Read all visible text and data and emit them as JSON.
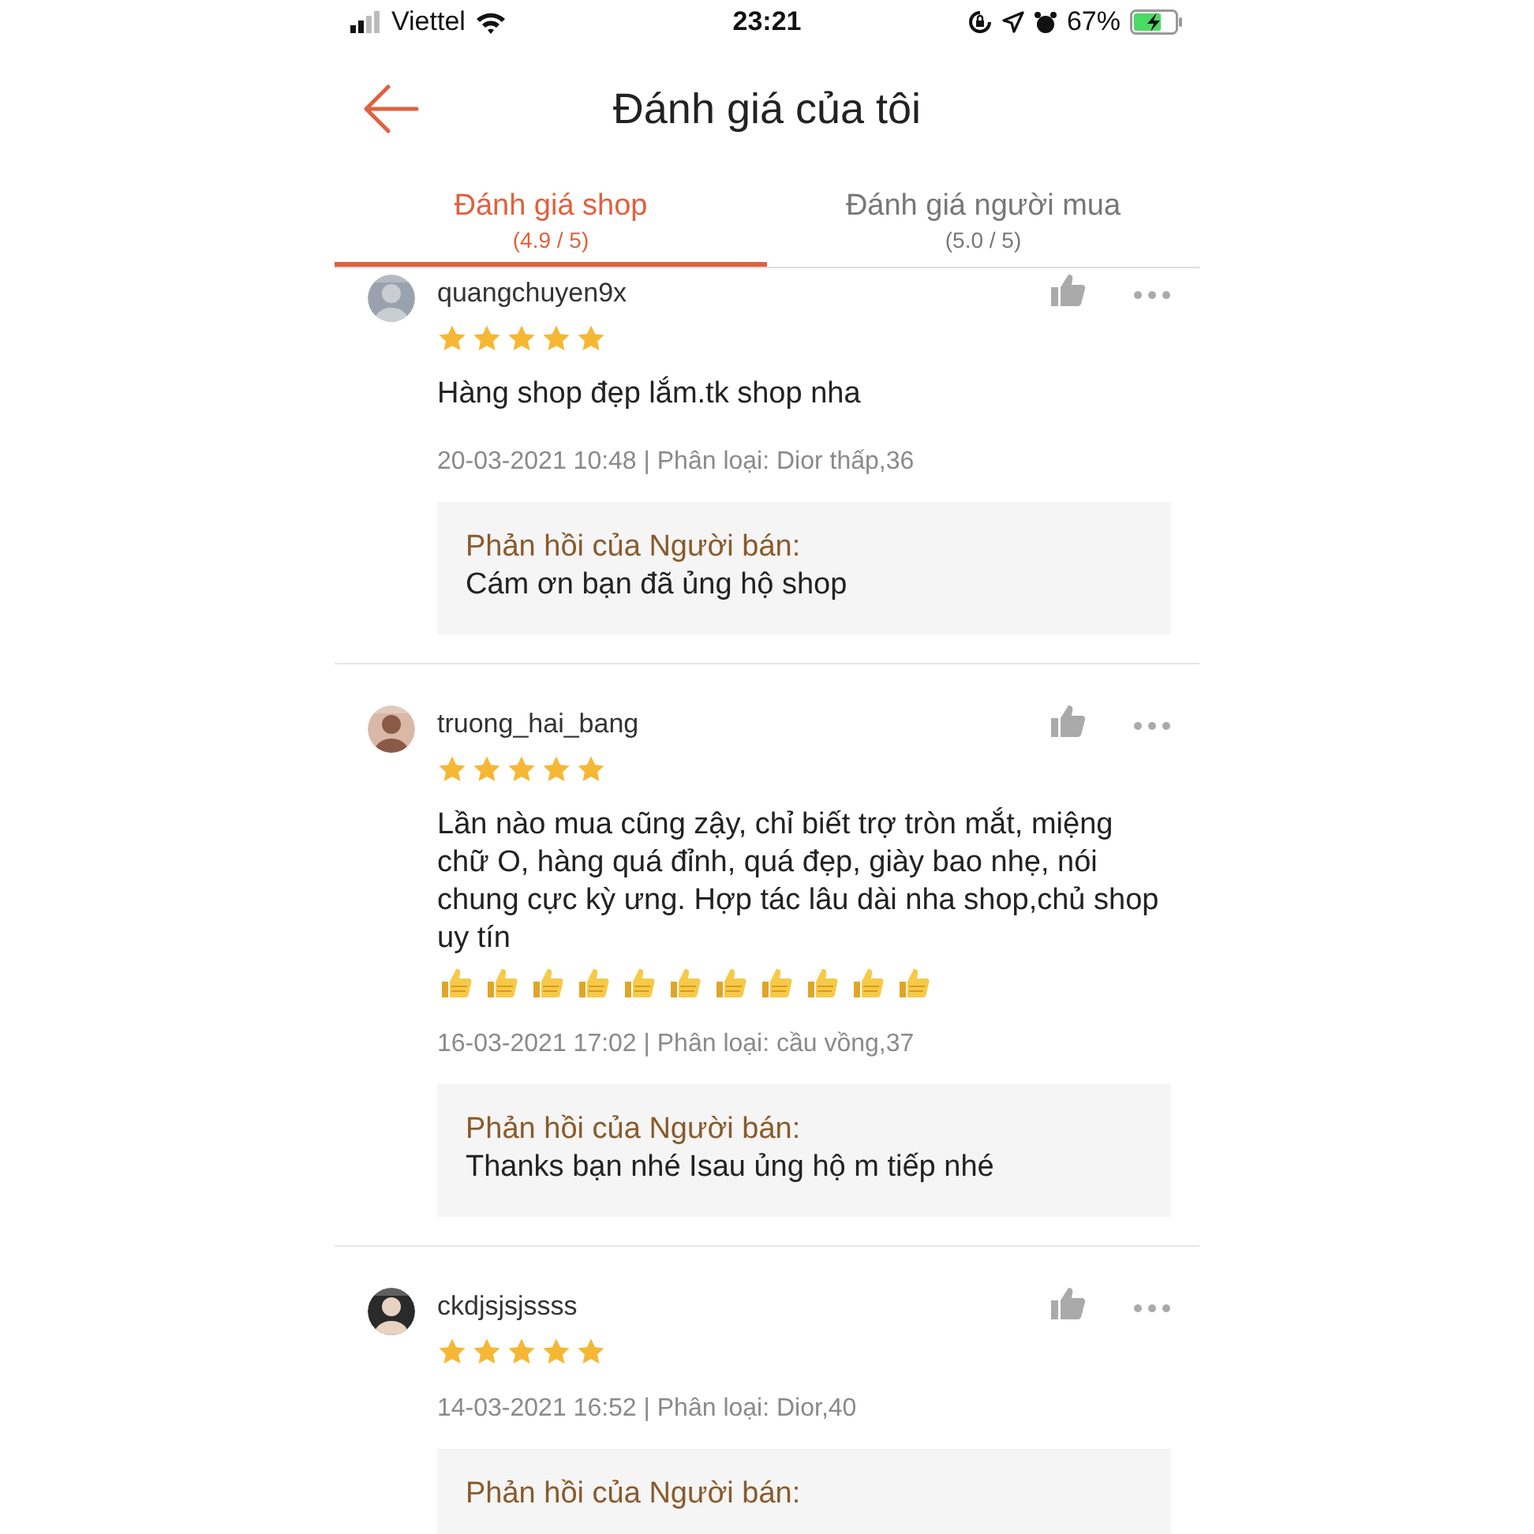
{
  "status_bar": {
    "carrier": "Viettel",
    "time": "23:21",
    "battery": "67%"
  },
  "header": {
    "title": "Đánh giá của tôi"
  },
  "tabs": [
    {
      "label": "Đánh giá shop",
      "score": "(4.9 / 5)",
      "selected": true
    },
    {
      "label": "Đánh giá người mua",
      "score": "(5.0 / 5)",
      "selected": false
    }
  ],
  "reviews": [
    {
      "user": "quangchuyen9x",
      "stars": 5,
      "comment": "Hàng shop đẹp lắm.tk shop nha",
      "meta": "20-03-2021 10:48 | Phân loại: Dior thấp,36",
      "reply": {
        "label": "Phản hồi của Người bán:",
        "text": "Cám ơn bạn đã ủng hộ shop"
      }
    },
    {
      "user": "truong_hai_bang",
      "stars": 5,
      "comment": "Lần nào mua cũng zậy, chỉ biết trợ tròn mắt, miệng chữ O, hàng quá đỉnh, quá đẹp, giày bao nhẹ, nói chung cực kỳ ưng. Hợp tác lâu dài nha shop,chủ shop uy tín",
      "emojis": [
        {
          "kind": "thumbs-up"
        },
        {
          "kind": "thumbs-up"
        },
        {
          "kind": "thumbs-up"
        },
        {
          "kind": "thumbs-up"
        },
        {
          "kind": "thumbs-up"
        },
        {
          "kind": "thumbs-up"
        },
        {
          "kind": "thumbs-up"
        },
        {
          "kind": "thumbs-up"
        },
        {
          "kind": "thumbs-up"
        },
        {
          "kind": "thumbs-up"
        },
        {
          "kind": "thumbs-up"
        }
      ],
      "meta": "16-03-2021 17:02 | Phân loại: cầu vồng,37",
      "reply": {
        "label": "Phản hồi của Người bán:",
        "text": "Thanks bạn nhé Isau ủng hộ m tiếp nhé"
      }
    },
    {
      "user": "ckdjsjsjssss",
      "stars": 5,
      "meta": "14-03-2021 16:52 | Phân loại: Dior,40",
      "reply": {
        "label": "Phản hồi của Người bán:"
      }
    }
  ]
}
